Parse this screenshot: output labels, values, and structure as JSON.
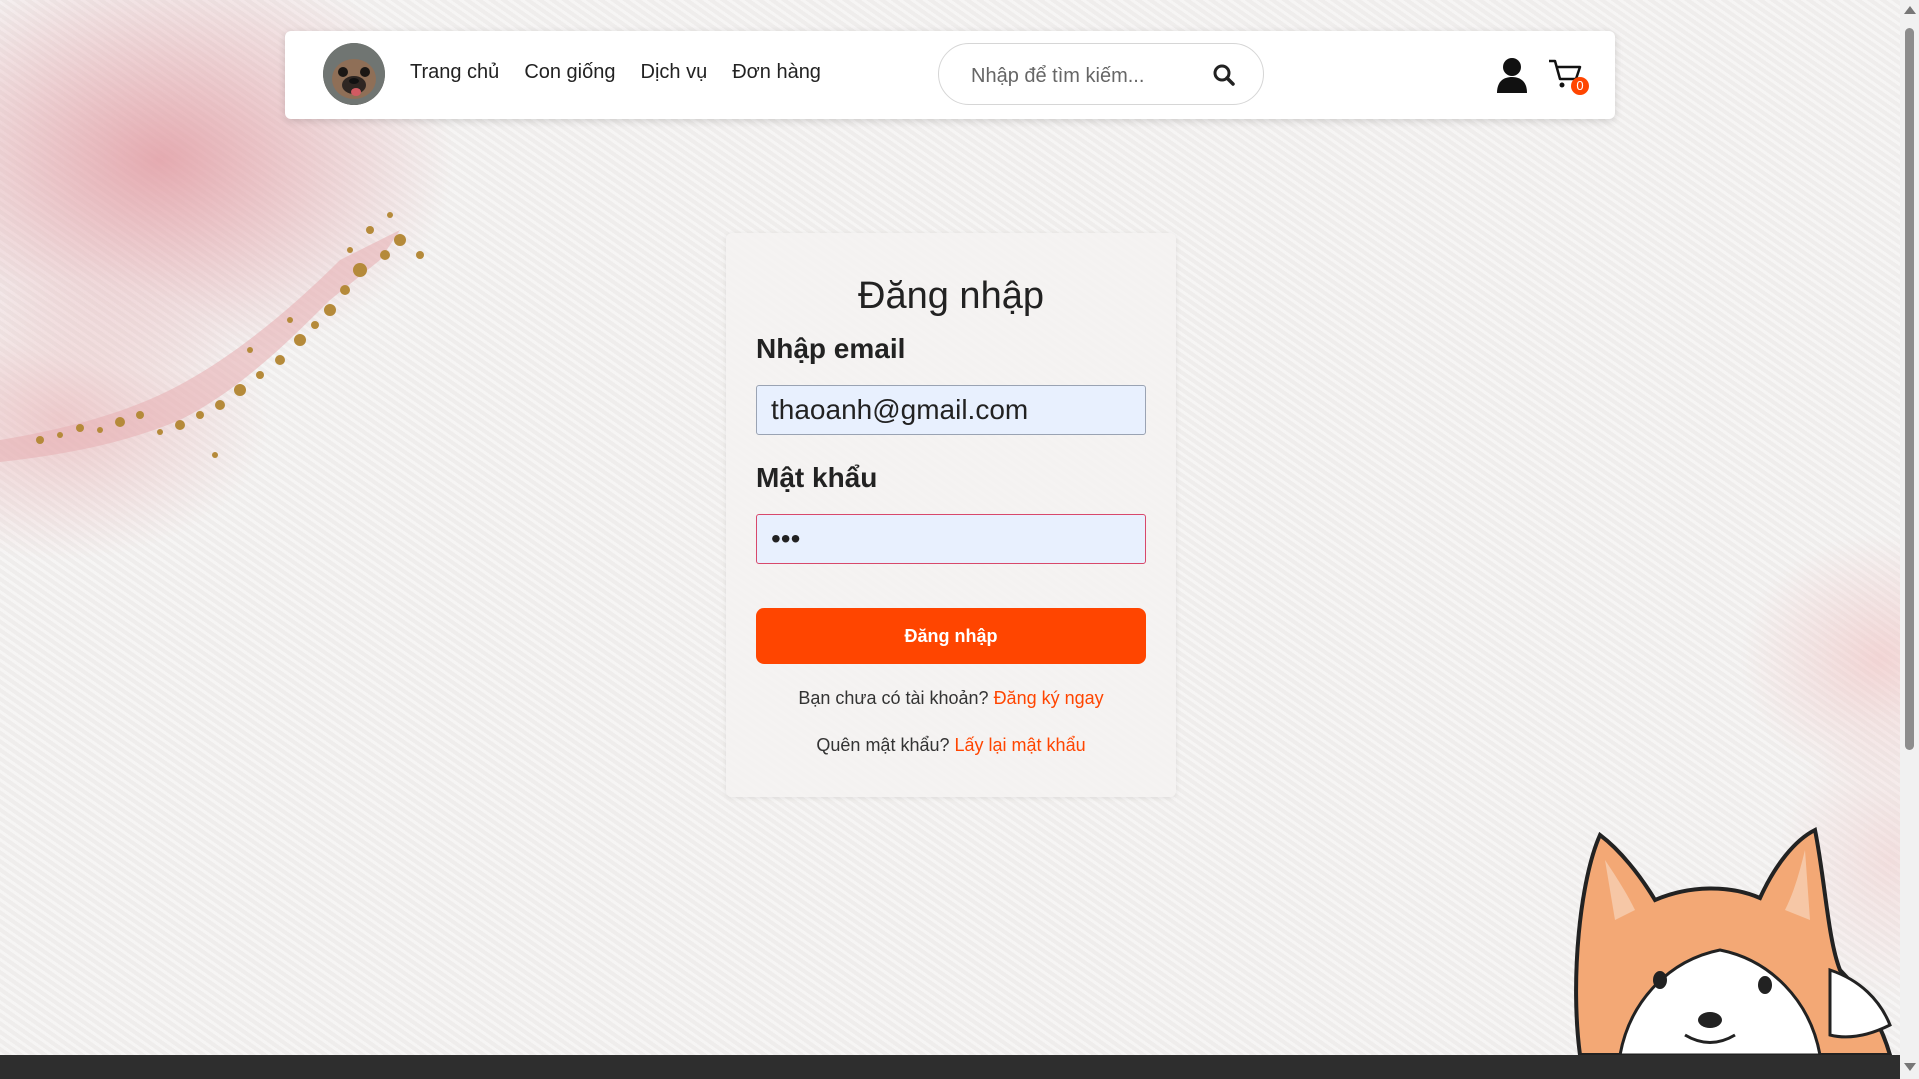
{
  "nav": {
    "links": [
      "Trang chủ",
      "Con giống",
      "Dịch vụ",
      "Đơn hàng"
    ],
    "search_placeholder": "Nhập để tìm kiếm...",
    "cart_count": "0"
  },
  "login": {
    "title": "Đăng nhập",
    "email_label": "Nhập email",
    "email_value": "thaoanh@gmail.com",
    "password_label": "Mật khẩu",
    "password_value": "•••",
    "submit_label": "Đăng nhập",
    "no_account_text": "Bạn chưa có tài khoản?",
    "register_link": "Đăng ký ngay",
    "forgot_text": "Quên mật khẩu?",
    "recover_link": "Lấy lại mật khẩu"
  },
  "colors": {
    "accent": "#ff4500",
    "input_bg": "#e8f0fe",
    "footer": "#2e2e2e"
  },
  "icons": [
    "logo-avatar",
    "search-icon",
    "user-icon",
    "cart-icon",
    "gold-leaf-decoration",
    "corgi-illustration"
  ]
}
